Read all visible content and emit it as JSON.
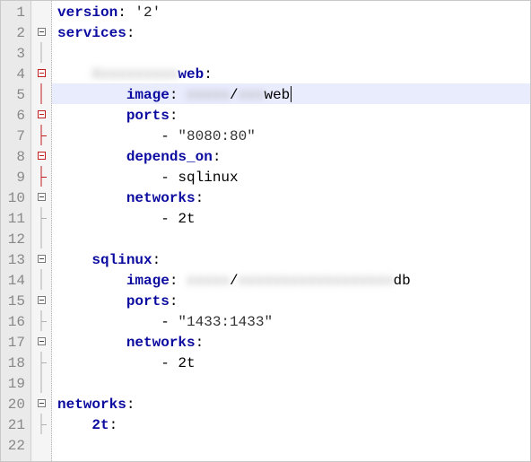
{
  "editor": {
    "highlighted_line": 5,
    "line_count": 22,
    "lines": {
      "1": {
        "indent": 0,
        "key": "version",
        "val": "'2'"
      },
      "2": {
        "indent": 0,
        "key": "services",
        "val": ":"
      },
      "4": {
        "indent": 1,
        "blur_pre": "Xxxxxxxxxx",
        "key_suffix": "web",
        "val": ":"
      },
      "5": {
        "indent": 2,
        "key": "image",
        "blur_mid": "xxxxx",
        "sep": "/",
        "blur_mid2": "xxx",
        "tail": "web"
      },
      "6": {
        "indent": 2,
        "key": "ports",
        "val": ":"
      },
      "7": {
        "indent": 3,
        "dash": "-",
        "str": "\"8080:80\""
      },
      "8": {
        "indent": 2,
        "key": "depends_on",
        "val": ":"
      },
      "9": {
        "indent": 3,
        "dash": "-",
        "plain": "sqlinux"
      },
      "10": {
        "indent": 2,
        "key": "networks",
        "val": ":"
      },
      "11": {
        "indent": 3,
        "dash": "-",
        "plain": "2t"
      },
      "13": {
        "indent": 1,
        "key": "sqlinux",
        "val": ":"
      },
      "14": {
        "indent": 2,
        "key": "image",
        "blur_mid": "xxxxx",
        "sep": "/",
        "blur_mid2": "xxxxxxxxxxxxxxxxxx",
        "tail": "db"
      },
      "15": {
        "indent": 2,
        "key": "ports",
        "val": ":"
      },
      "16": {
        "indent": 3,
        "dash": "-",
        "str": "\"1433:1433\""
      },
      "17": {
        "indent": 2,
        "key": "networks",
        "val": ":"
      },
      "18": {
        "indent": 3,
        "dash": "-",
        "plain": "2t"
      },
      "20": {
        "indent": 0,
        "key": "networks",
        "val": ":"
      },
      "21": {
        "indent": 1,
        "key": "2t",
        "val": ":"
      }
    }
  },
  "fold": {
    "2": {
      "box": "gray"
    },
    "4": {
      "box": "red"
    },
    "5": {
      "bar": "red"
    },
    "6": {
      "box": "red"
    },
    "7": {
      "bar": "red",
      "corner": "red"
    },
    "8": {
      "box": "red"
    },
    "9": {
      "bar": "red",
      "corner": "red"
    },
    "10": {
      "box": "gray"
    },
    "11": {
      "bar": "gray",
      "corner": "gray"
    },
    "13": {
      "box": "gray"
    },
    "14": {
      "bar": "gray"
    },
    "15": {
      "box": "gray"
    },
    "16": {
      "bar": "gray",
      "corner": "gray"
    },
    "17": {
      "box": "gray"
    },
    "18": {
      "bar": "gray",
      "corner": "gray"
    },
    "20": {
      "box": "gray"
    },
    "21": {
      "bar": "gray",
      "corner": "gray"
    }
  }
}
